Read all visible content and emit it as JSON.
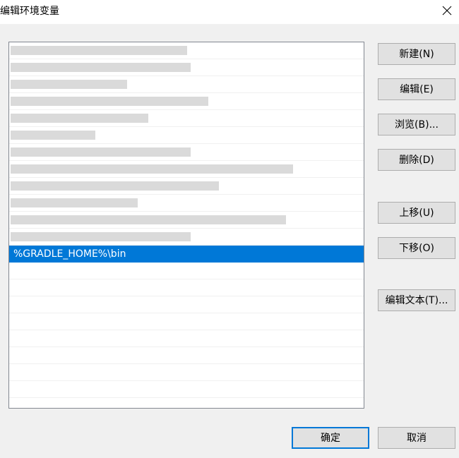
{
  "window": {
    "title": "编辑环境变量",
    "close_icon": "close-icon"
  },
  "list": {
    "selected_value": "%GRADLE_HOME%\\bin",
    "blurred_entry_count": 12
  },
  "buttons": {
    "new": "新建(N)",
    "edit": "编辑(E)",
    "browse": "浏览(B)...",
    "delete": "删除(D)",
    "move_up": "上移(U)",
    "move_down": "下移(O)",
    "edit_text": "编辑文本(T)...",
    "ok": "确定",
    "cancel": "取消"
  },
  "colors": {
    "selection": "#0078d7",
    "dialog_background": "#f0f0f0",
    "button_background": "#e1e1e1"
  }
}
